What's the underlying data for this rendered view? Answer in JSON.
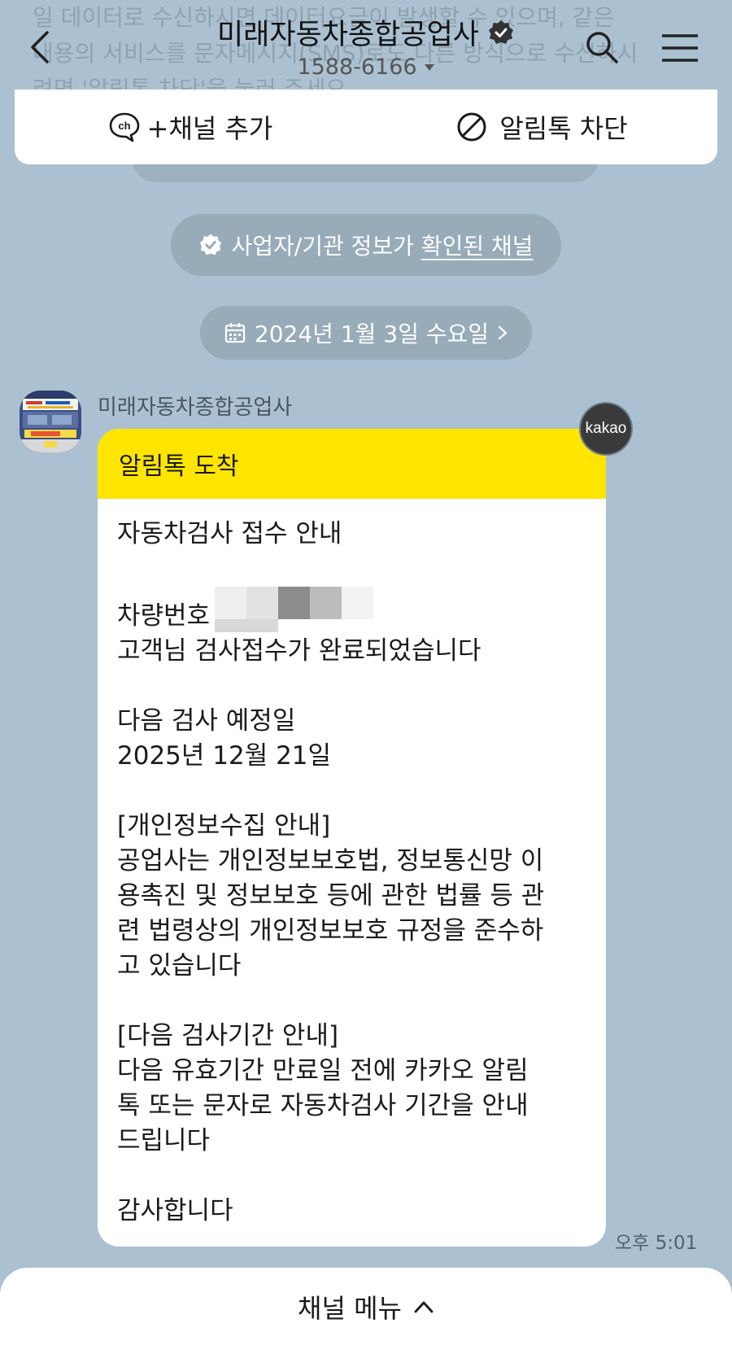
{
  "header": {
    "faded_text": "일 데이터로 수신하시면 데이터요금이 발생할 수 있으며, 같은\n내용의 서비스를 문자메시지(SMS)로도 다른 방식으로 수신하시\n려면 '알림톡 차단'을 눌러 주세요",
    "title": "미래자동차종합공업사",
    "phone": "1588-6166"
  },
  "actions": {
    "add_channel": "+채널 추가",
    "block_alimtalk": "알림톡 차단"
  },
  "notices": {
    "business_prefix": "사업자/기관 정보가 ",
    "business_link": "확인된 채널",
    "date": "2024년 1월 3일 수요일"
  },
  "message": {
    "sender": "미래자동차종합공업사",
    "header": "알림톡 도착",
    "badge": "kakao",
    "lines": {
      "l1": "자동차검사 접수 안내",
      "l2": "차량번호",
      "l3": "고객님 검사접수가 완료되었습니다",
      "l4": "다음 검사 예정일",
      "l5": "2025년 12월 21일",
      "l6": "[개인정보수집 안내]",
      "l7": "공업사는 개인정보보호법, 정보통신망 이",
      "l8": "용촉진 및 정보보호 등에 관한 법률 등 관",
      "l9": "련 법령상의 개인정보보호 규정을 준수하",
      "l10": "고 있습니다",
      "l11": "[다음 검사기간 안내]",
      "l12": "다음 유효기간 만료일 전에 카카오 알림",
      "l13": "톡 또는 문자로 자동차검사 기간을 안내",
      "l14": "드립니다",
      "l15": "감사합니다"
    },
    "time": "오후 5:01"
  },
  "bottom": {
    "menu_label": "채널 메뉴"
  },
  "colors": {
    "background": "#abc1d1",
    "bubble_header": "#fee500",
    "pill": "#97abb9"
  },
  "icons": [
    "back-arrow-icon",
    "verified-icon",
    "caret-down-icon",
    "search-icon",
    "hamburger-menu-icon",
    "channel-add-icon",
    "block-icon",
    "badge-check-icon",
    "calendar-icon",
    "chevron-right-icon",
    "chevron-up-icon"
  ]
}
